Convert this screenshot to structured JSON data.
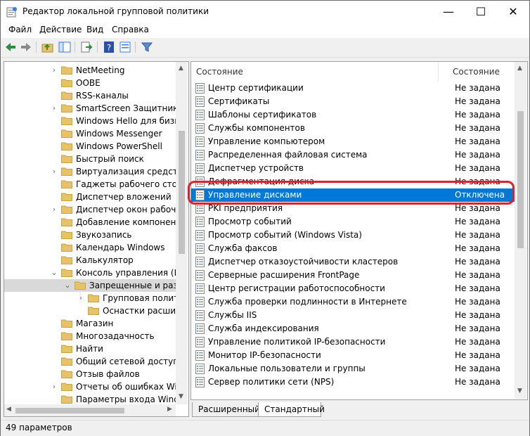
{
  "window": {
    "title": "Редактор локальной групповой политики"
  },
  "menu": [
    "Файл",
    "Действие",
    "Вид",
    "Справка"
  ],
  "tree": {
    "items": [
      {
        "label": "NetMeeting",
        "chev": "›",
        "level": 0
      },
      {
        "label": "OOBE",
        "chev": "",
        "level": 0
      },
      {
        "label": "RSS-каналы",
        "chev": "",
        "level": 0
      },
      {
        "label": "SmartScreen Защитника W",
        "chev": "›",
        "level": 0
      },
      {
        "label": "Windows Hello для бизнес",
        "chev": "",
        "level": 0
      },
      {
        "label": "Windows Messenger",
        "chev": "",
        "level": 0
      },
      {
        "label": "Windows PowerShell",
        "chev": "",
        "level": 0
      },
      {
        "label": "Быстрый поиск",
        "chev": "",
        "level": 0
      },
      {
        "label": "Виртуализация средств вз",
        "chev": "›",
        "level": 0
      },
      {
        "label": "Гаджеты рабочего стола",
        "chev": "",
        "level": 0
      },
      {
        "label": "Диспетчер вложений",
        "chev": "",
        "level": 0
      },
      {
        "label": "Диспетчер окон рабочего",
        "chev": "›",
        "level": 0
      },
      {
        "label": "Добавление компонентов",
        "chev": "",
        "level": 0
      },
      {
        "label": "Звукозапись",
        "chev": "",
        "level": 0
      },
      {
        "label": "Календарь Windows",
        "chev": "",
        "level": 0
      },
      {
        "label": "Калькулятор",
        "chev": "",
        "level": 0
      },
      {
        "label": "Консоль управления (MM",
        "chev": "⌄",
        "level": 0
      },
      {
        "label": "Запрещенные и разре",
        "chev": "⌄",
        "level": 1,
        "selected": true
      },
      {
        "label": "Групповая полити",
        "chev": "›",
        "level": 2
      },
      {
        "label": "Оснастки расшире",
        "chev": "",
        "level": 2
      },
      {
        "label": "Магазин",
        "chev": "",
        "level": 0
      },
      {
        "label": "Многозадачность",
        "chev": "",
        "level": 0
      },
      {
        "label": "Найти",
        "chev": "",
        "level": 0
      },
      {
        "label": "Общий сетевой доступ",
        "chev": "",
        "level": 0
      },
      {
        "label": "Отзыв файлов",
        "chev": "",
        "level": 0
      },
      {
        "label": "Отчеты об ошибках Wind",
        "chev": "›",
        "level": 0
      },
      {
        "label": "Параметры входа Window",
        "chev": "",
        "level": 0
      }
    ]
  },
  "list": {
    "col_name": "Состояние",
    "col_state": "Состояние",
    "rows": [
      {
        "name": "Центр сертификации",
        "state": "Не задана"
      },
      {
        "name": "Сертификаты",
        "state": "Не задана"
      },
      {
        "name": "Шаблоны сертификатов",
        "state": "Не задана"
      },
      {
        "name": "Службы компонентов",
        "state": "Не задана"
      },
      {
        "name": "Управление компьютером",
        "state": "Не задана"
      },
      {
        "name": "Распределенная файловая система",
        "state": "Не задана"
      },
      {
        "name": "Диспетчер устройств",
        "state": "Не задана"
      },
      {
        "name": "Дефрагментация диска",
        "state": "Не задана"
      },
      {
        "name": "Управление дисками",
        "state": "Отключена",
        "selected": true
      },
      {
        "name": "PKI предприятия",
        "state": "Не задана"
      },
      {
        "name": "Просмотр событий",
        "state": "Не задана"
      },
      {
        "name": "Просмотр событий (Windows Vista)",
        "state": "Не задана"
      },
      {
        "name": "Служба факсов",
        "state": "Не задана"
      },
      {
        "name": "Диспетчер отказоустойчивости кластеров",
        "state": "Не задана"
      },
      {
        "name": "Серверные расширения FrontPage",
        "state": "Не задана"
      },
      {
        "name": "Центр регистрации работоспособности",
        "state": "Не задана"
      },
      {
        "name": "Служба проверки подлинности в Интернете",
        "state": "Не задана"
      },
      {
        "name": "Службы IIS",
        "state": "Не задана"
      },
      {
        "name": "Служба индексирования",
        "state": "Не задана"
      },
      {
        "name": "Управление политикой IP-безопасности",
        "state": "Не задана"
      },
      {
        "name": "Монитор IP-безопасности",
        "state": "Не задана"
      },
      {
        "name": "Локальные пользователи и группы",
        "state": "Не задана"
      },
      {
        "name": "Сервер политики сети (NPS)",
        "state": "Не задана"
      }
    ]
  },
  "tabs": [
    "Расширенный",
    "Стандартный"
  ],
  "status": "49 параметров",
  "colors": {
    "selection": "#0078d7",
    "highlight_ring": "#e0202a",
    "folder": "#e8c266"
  }
}
